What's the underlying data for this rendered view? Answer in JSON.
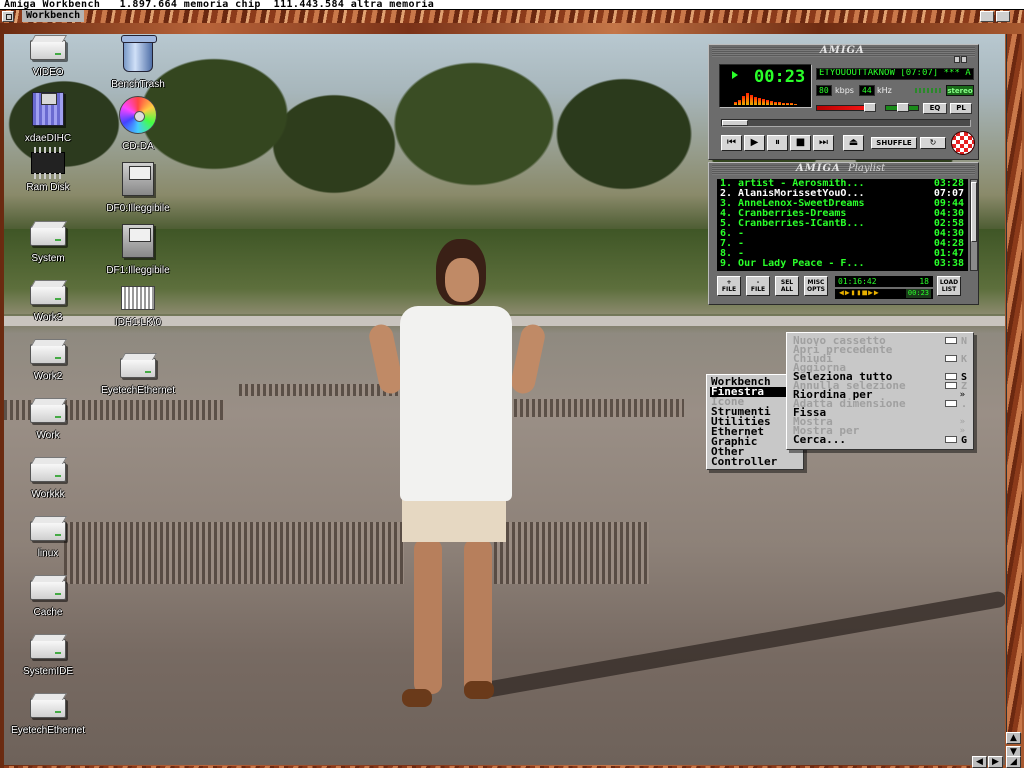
{
  "screen": {
    "title": "Amiga Workbench   1.897.664 memoria chip  111.443.584 altra memoria"
  },
  "window": {
    "title": "Workbench"
  },
  "icons_col1": [
    {
      "label": "VIDEO",
      "icon": "harddisk-icon"
    },
    {
      "label": "xdaeDIHC",
      "icon": "floppy-icon"
    },
    {
      "label": "Ram Disk",
      "icon": "ramdisk-chip-icon"
    },
    {
      "label": "System",
      "icon": "harddisk-icon"
    },
    {
      "label": "Work3",
      "icon": "harddisk-icon"
    },
    {
      "label": "Work2",
      "icon": "harddisk-icon"
    },
    {
      "label": "Work",
      "icon": "harddisk-icon"
    },
    {
      "label": "Workkk",
      "icon": "harddisk-icon"
    },
    {
      "label": "linux",
      "icon": "harddisk-icon"
    },
    {
      "label": "Cache",
      "icon": "harddisk-icon"
    },
    {
      "label": "SystemIDE",
      "icon": "harddisk-icon"
    },
    {
      "label": "EyetechEthernet",
      "icon": "harddisk-icon"
    }
  ],
  "icons_col2": [
    {
      "label": "BenchTrash",
      "icon": "trashcan-icon"
    },
    {
      "label": "CD-DA",
      "icon": "cd-icon"
    },
    {
      "label": "DF0:Illeggibile",
      "icon": "unreadable-floppy-icon"
    },
    {
      "label": "DF1:Illeggibile",
      "icon": "unreadable-floppy-icon"
    },
    {
      "label": "IDH1:LK\\0",
      "icon": "unreadable-disk-icon"
    },
    {
      "label": "EyetechEthernet",
      "icon": "harddisk-icon"
    }
  ],
  "player": {
    "logo": "AMIGA",
    "time": "00:23",
    "song": "ETYOUOUTTAKNOW [07:07]  ***  A",
    "kbps": "80",
    "kbps_unit": "kbps",
    "khz": "44",
    "khz_unit": "kHz",
    "stereo": "stereo",
    "eq_label": "EQ",
    "pl_label": "PL",
    "shuffle_label": "SHUFFLE",
    "progress": 0.05,
    "volume": 0.8,
    "colors": {
      "lcd": "#2aff2a",
      "accent": "#e62020"
    }
  },
  "playlist": {
    "logo": "AMIGA",
    "subtitle": "Playlist",
    "rows": [
      {
        "title": "1. artist - Aerosmith...",
        "dur": "03:28",
        "current": false
      },
      {
        "title": "2. AlanisMorissetYouO...",
        "dur": "07:07",
        "current": true
      },
      {
        "title": "3. AnneLenox-SweetDreams",
        "dur": "09:44",
        "current": false
      },
      {
        "title": "4. Cranberries-Dreams",
        "dur": "04:30",
        "current": false
      },
      {
        "title": "5. Cranberries-ICantB...",
        "dur": "02:58",
        "current": false
      },
      {
        "title": "6.  -",
        "dur": "04:30",
        "current": false
      },
      {
        "title": "7.  -",
        "dur": "04:28",
        "current": false
      },
      {
        "title": "8.  -",
        "dur": "01:47",
        "current": false
      },
      {
        "title": "9. Our Lady Peace - F...",
        "dur": "03:38",
        "current": false
      }
    ],
    "buttons": [
      {
        "line1": "+",
        "line2": "FILE"
      },
      {
        "line1": "-",
        "line2": "FILE"
      },
      {
        "line1": "SEL",
        "line2": "ALL"
      },
      {
        "line1": "MISC",
        "line2": "OPTS"
      }
    ],
    "total_time": "01:16:42",
    "count": "18",
    "mini_time": "00:23",
    "load_label_1": "LOAD",
    "load_label_2": "LIST"
  },
  "menu": {
    "title": "Workbench",
    "items": [
      {
        "label": "Finestra",
        "selected": true,
        "ghost": false
      },
      {
        "label": "Icone",
        "selected": false,
        "ghost": true
      },
      {
        "label": "Strumenti",
        "selected": false,
        "ghost": false
      },
      {
        "label": "Utilities",
        "selected": false,
        "ghost": false
      },
      {
        "label": "Ethernet",
        "selected": false,
        "ghost": false
      },
      {
        "label": "Graphic",
        "selected": false,
        "ghost": false
      },
      {
        "label": "Other",
        "selected": false,
        "ghost": false
      },
      {
        "label": "Controller",
        "selected": false,
        "ghost": false
      }
    ]
  },
  "submenu": {
    "items": [
      {
        "label": "Nuovo cassetto",
        "key": "N",
        "ghost": true,
        "arrow": false
      },
      {
        "label": "Apri precedente",
        "key": "",
        "ghost": true,
        "arrow": false
      },
      {
        "label": "Chiudi",
        "key": "K",
        "ghost": true,
        "arrow": false
      },
      {
        "label": "Aggiorna",
        "key": "",
        "ghost": true,
        "arrow": false
      },
      {
        "label": "Seleziona tutto",
        "key": "S",
        "ghost": false,
        "arrow": false
      },
      {
        "label": "Annulla selezione",
        "key": "Z",
        "ghost": true,
        "arrow": false
      },
      {
        "label": "Riordina per",
        "key": "",
        "ghost": false,
        "arrow": true
      },
      {
        "label": "Adatta dimensione",
        "key": ".",
        "ghost": true,
        "arrow": false
      },
      {
        "label": "Fissa",
        "key": "",
        "ghost": false,
        "arrow": false
      },
      {
        "label": "Mostra",
        "key": "",
        "ghost": true,
        "arrow": true
      },
      {
        "label": "Mostra per",
        "key": "",
        "ghost": true,
        "arrow": true
      },
      {
        "label": "Cerca...",
        "key": "G",
        "ghost": false,
        "arrow": false
      }
    ]
  },
  "colors": {
    "frame": "#b8643a",
    "menu_bg": "#c8c8c8",
    "lcd_green": "#2aff2a"
  }
}
